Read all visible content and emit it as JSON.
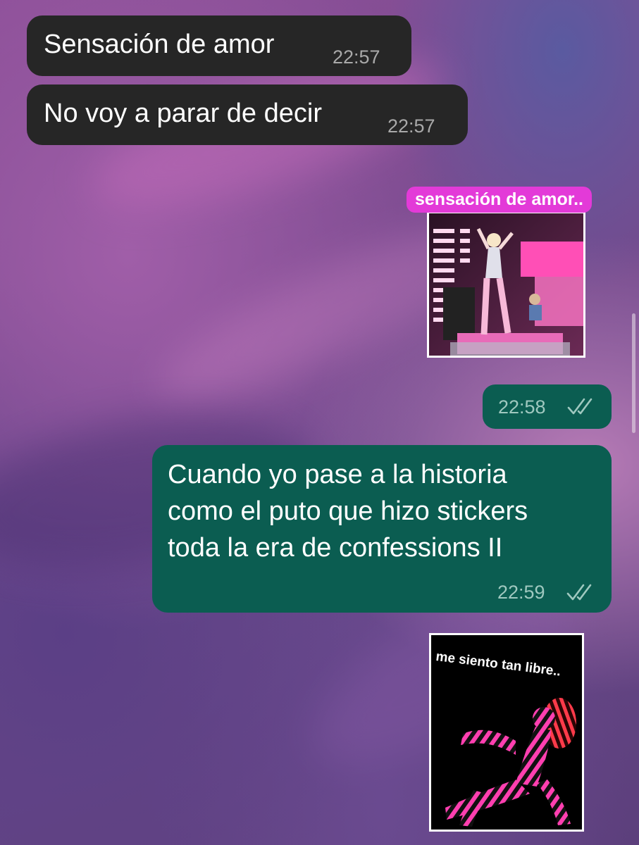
{
  "chat": {
    "messages": [
      {
        "direction": "incoming",
        "type": "text",
        "text": "Sensación de amor",
        "time": "22:57"
      },
      {
        "direction": "incoming",
        "type": "text",
        "text": "No voy a parar de decir",
        "time": "22:57"
      },
      {
        "direction": "outgoing",
        "type": "sticker",
        "caption": "sensación de amor..",
        "time": "22:58",
        "status": "double-check-icon"
      },
      {
        "direction": "outgoing",
        "type": "text",
        "text": "Cuando yo pase a la historia\ncomo el puto que hizo stickers\ntoda la era de confessions II",
        "time": "22:59",
        "status": "double-check-icon"
      },
      {
        "direction": "incoming",
        "type": "sticker",
        "caption": "me siento tan libre.."
      }
    ]
  },
  "colors": {
    "incoming_bubble": "#262626",
    "outgoing_bubble": "#0b5d51",
    "sticker_caption_bg": "#e33ad8"
  }
}
